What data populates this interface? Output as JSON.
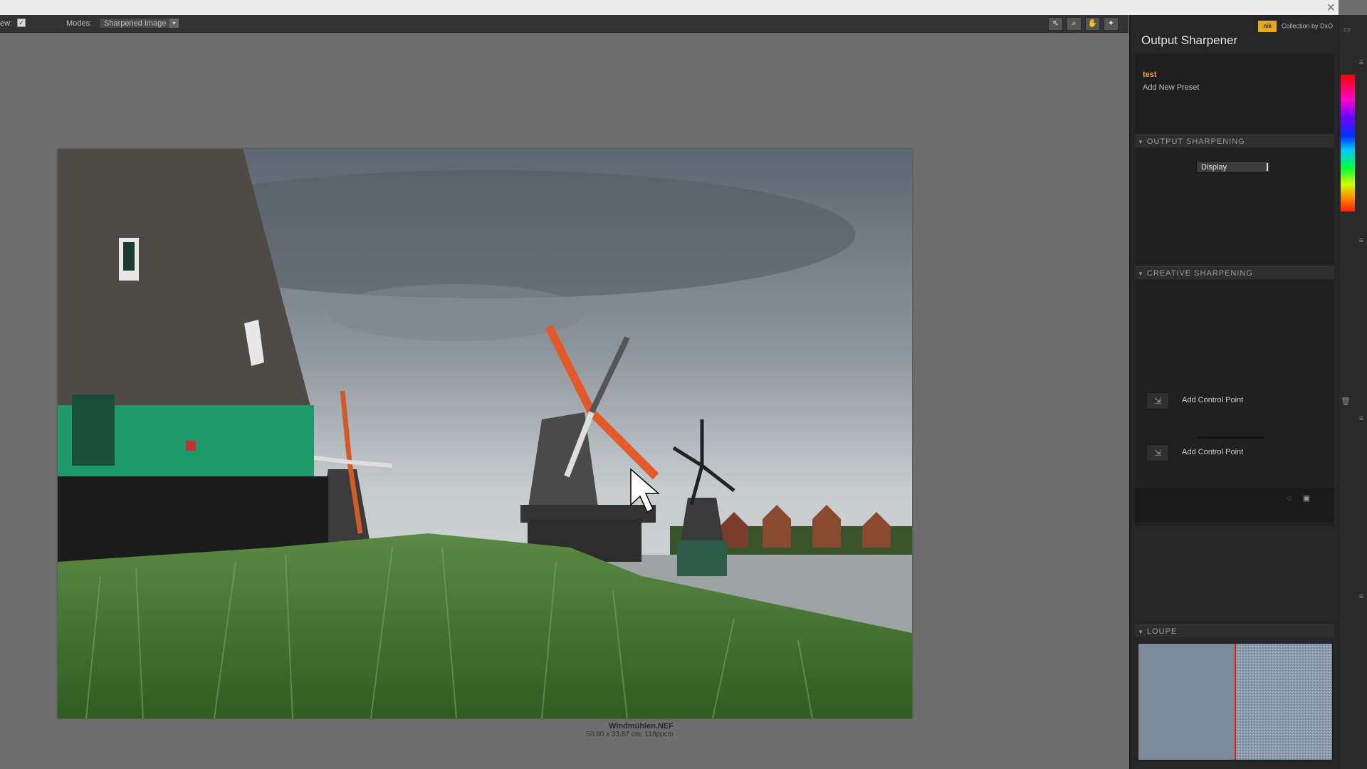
{
  "toolbar": {
    "view_label": "ew:",
    "view_check": "✓",
    "modes_label": "Modes:",
    "modes_value": "Sharpened Image",
    "modes_arrow": "▾",
    "tools": [
      "⇖",
      "⌕",
      "✋",
      "✦"
    ]
  },
  "canvas": {
    "file_name": "Windmühlen.NEF",
    "file_dims": "50.80 x 33.87 cm, 118ppcm"
  },
  "panel": {
    "title": "Output Sharpener",
    "brand_logo": "nik",
    "brand_text": "Collection by DxO",
    "preset_name": "test",
    "add_preset": "Add New Preset",
    "output_sharpening": {
      "header": "OUTPUT SHARPENING",
      "dropdown_value": "Display"
    },
    "creative_sharpening": {
      "header": "CREATIVE SHARPENING",
      "control_points": [
        {
          "label": "Add Control Point",
          "icon": "⇲"
        },
        {
          "label": "Add Control Point",
          "icon": "⇲"
        }
      ]
    },
    "actions": [
      "◌",
      "▣"
    ],
    "loupe": {
      "header": "LOUPE"
    }
  },
  "window": {
    "close": "✕"
  },
  "colors": {
    "accent_orange": "#f1a33b",
    "brand_yellow": "#e4a821",
    "loupe_divider": "#e81919"
  }
}
